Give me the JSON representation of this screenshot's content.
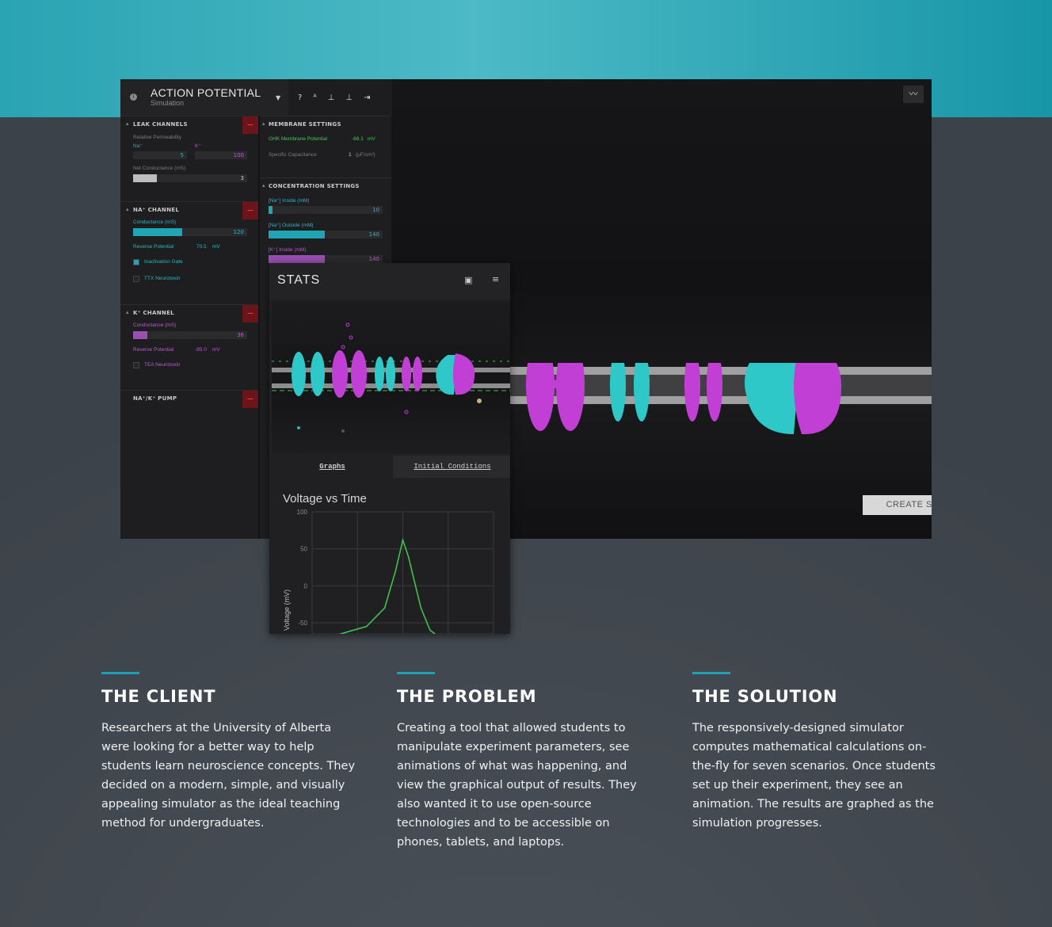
{
  "app": {
    "title": "ACTION POTENTIAL",
    "subtitle": "Simulation",
    "tools": [
      "?",
      "ᴬ",
      "⊥",
      "⊥",
      "⇥"
    ],
    "create_button": "CREATE SIMULATION"
  },
  "left_panel": {
    "leak": {
      "label": "LEAK CHANNELS",
      "rel_perm": "Relative Permeability",
      "na_label": "Na⁺",
      "k_label": "K⁺",
      "na_value": "5",
      "k_value": "100",
      "net_label": "Net Conductance (mS)",
      "net_value": "3"
    },
    "na": {
      "label": "NA⁺ CHANNEL",
      "cond_label": "Conductance (mS)",
      "cond_value": "120",
      "rev_label": "Reverse Potential",
      "rev_value": "70.5",
      "rev_unit": "mV",
      "gate_label": "Inactivation Gate",
      "toxin_label": "TTX Neurotoxin"
    },
    "k": {
      "label": "K⁺ CHANNEL",
      "cond_label": "Conductance (mS)",
      "cond_value": "36",
      "rev_label": "Reverse Potential",
      "rev_value": "-95.0",
      "rev_unit": "mV",
      "toxin_label": "TEA Neurotoxin"
    },
    "pump": {
      "label": "NA⁺/K⁺ PUMP"
    }
  },
  "mid_panel": {
    "membrane": {
      "label": "MEMBRANE SETTINGS",
      "ghk_label": "GHK Membrane Potential",
      "ghk_value": "-68.1",
      "ghk_unit": "mV",
      "cap_label": "Specific Capacitance",
      "cap_value": "1",
      "cap_unit": "(μF/cm²)"
    },
    "conc": {
      "label": "CONCENTRATION SETTINGS",
      "na_in_label": "[Na⁺] Inside (mM)",
      "na_in_value": "10",
      "na_out_label": "[Na⁺] Outside (mM)",
      "na_out_value": "140",
      "k_in_label": "[K⁺] Inside (mM)",
      "k_in_value": "140"
    }
  },
  "stats": {
    "title": "STATS",
    "tabs": {
      "graphs": "Graphs",
      "initial": "Initial Conditions"
    }
  },
  "colors": {
    "teal": "#2fc8c8",
    "magenta": "#c23fd6",
    "accent": "#1ba2b6",
    "trace": "#3fc24a"
  },
  "chart_data": {
    "type": "line",
    "title": "Voltage vs Time",
    "xlabel": "",
    "ylabel": "Voltage (mV)",
    "ylim": [
      -50,
      100
    ],
    "yticks": [
      "100",
      "50",
      "0",
      "-50"
    ],
    "grid": true,
    "series": [
      {
        "x": [
          0,
          0.1,
          0.2,
          0.3,
          0.4,
          0.46,
          0.5,
          0.53,
          0.56,
          0.6,
          0.65,
          0.7,
          0.78,
          0.9
        ],
        "values": [
          -68,
          -66,
          -62,
          -55,
          -30,
          20,
          62,
          40,
          10,
          -30,
          -60,
          -72,
          -70,
          -68
        ]
      }
    ]
  },
  "sections": [
    {
      "heading": "THE CLIENT",
      "lines": [
        "Researchers at the University of Alberta",
        "were looking for a better way to help",
        "students learn neuroscience concepts. They",
        "decided on a modern, simple, and visually",
        "appealing simulator as the ideal teaching",
        "method for undergraduates."
      ]
    },
    {
      "heading": "THE PROBLEM",
      "lines": [
        "Creating a tool that allowed students to",
        "manipulate experiment parameters, see",
        "animations of what was happening, and",
        "view the graphical output of results. They",
        "also wanted it to use open-source",
        "technologies and to be accessible on",
        "phones, tablets, and laptops."
      ]
    },
    {
      "heading": "THE SOLUTION",
      "lines": [
        "The responsively-designed simulator",
        "computes mathematical calculations on-",
        "the-fly for seven scenarios. Once students",
        "set up their experiment, they see an",
        "animation. The results are graphed as the",
        "simulation progresses."
      ]
    }
  ]
}
